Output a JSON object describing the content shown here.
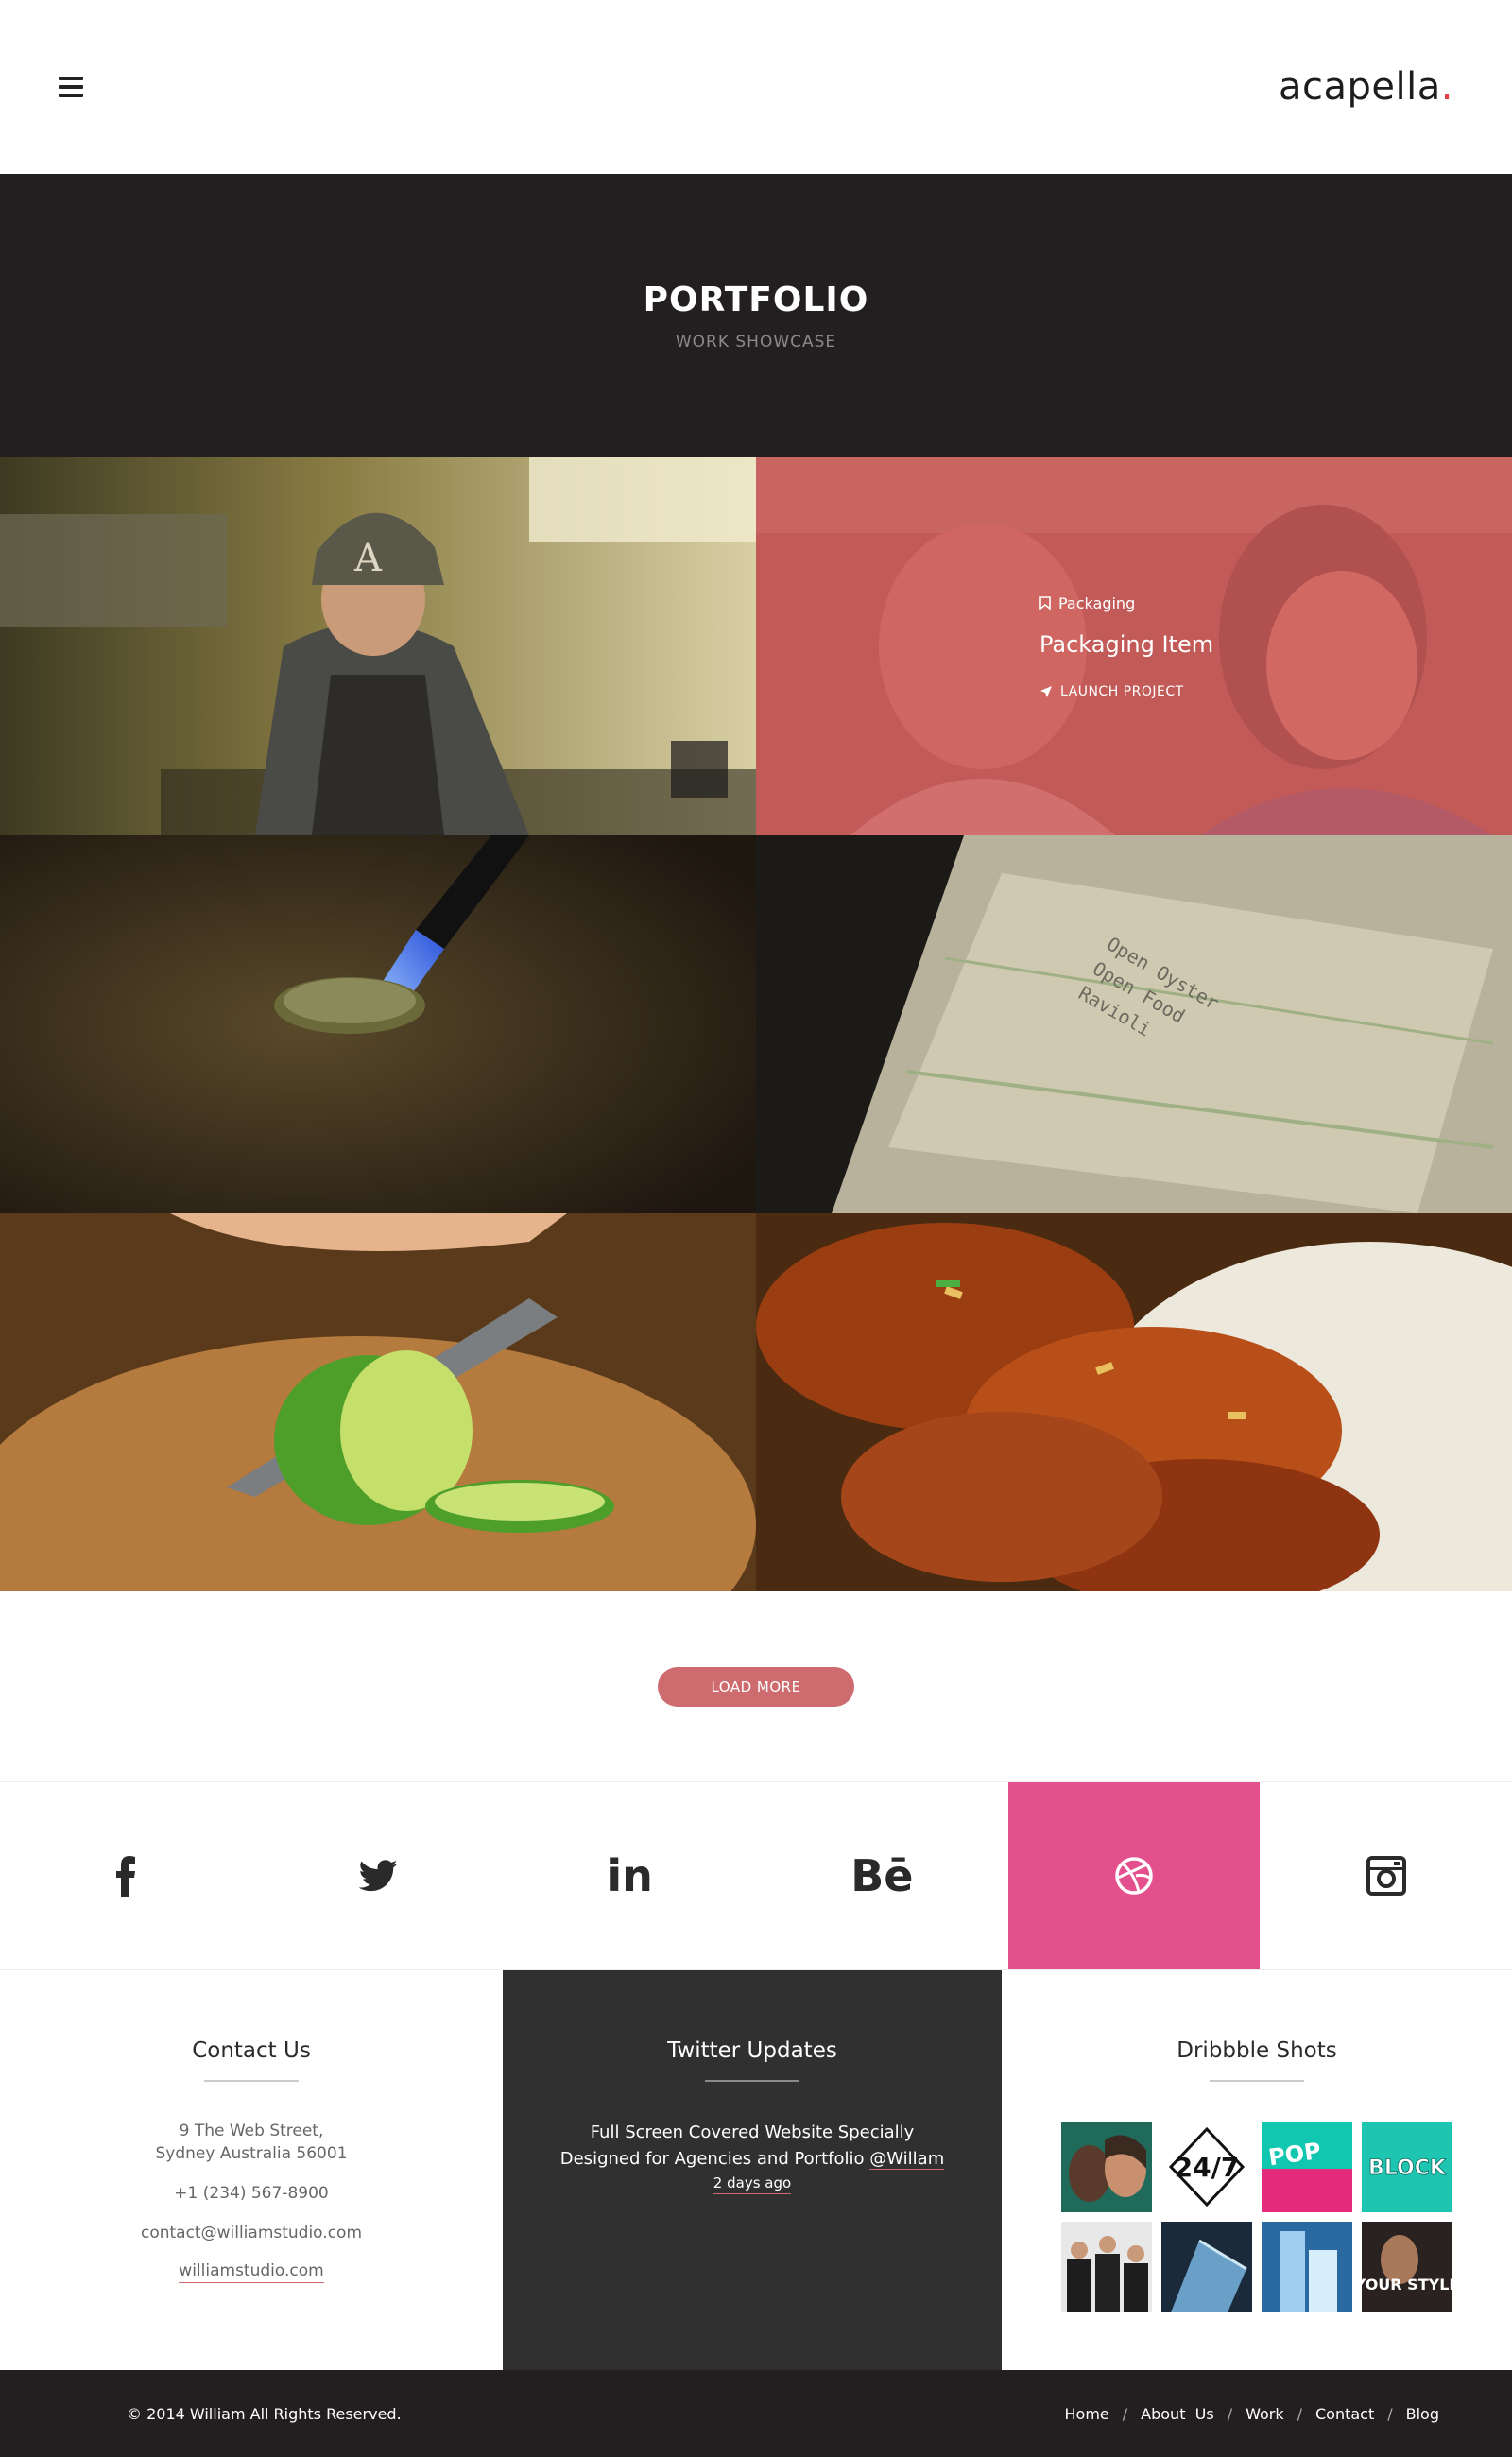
{
  "header": {
    "logo_text": "acapella",
    "logo_dot": ".",
    "menu_icon": "hamburger-icon"
  },
  "hero": {
    "title": "PORTFOLIO",
    "subtitle": "WORK SHOWCASE"
  },
  "portfolio": {
    "hover_item": {
      "category": "Packaging",
      "title": "Packaging Item",
      "link": "LAUNCH PROJECT"
    },
    "load_more": "LOAD MORE"
  },
  "social": [
    "facebook-icon",
    "twitter-icon",
    "linkedin-icon",
    "behance-icon",
    "dribbble-icon",
    "instagram-icon"
  ],
  "social_labels": {
    "linkedin": "in",
    "behance": "Bē"
  },
  "colors": {
    "accent": "#cd6b6f",
    "dribbble_active": "#e4508e",
    "dark": "#231f20",
    "overlay": "#d65f5f"
  },
  "contact": {
    "title": "Contact Us",
    "address_line1": "9 The Web Street,",
    "address_line2": "Sydney Australia 56001",
    "phone": "+1 (234) 567-8900",
    "email": "contact@williamstudio.com",
    "website": "williamstudio.com"
  },
  "twitter": {
    "title": "Twitter Updates",
    "line1": "Full Screen Covered Website Specially",
    "line2": "Designed for Agencies and Portfolio",
    "handle": "@Willam",
    "time": "2 days ago"
  },
  "dribbble": {
    "title": "Dribbble Shots",
    "shot_247": "24/7",
    "shot_pop": "POP",
    "shot_block": "BLOCK",
    "shot_style": "YOUR STYLE"
  },
  "footer": {
    "copyright": "© 2014 William All Rights Reserved.",
    "nav": [
      "Home",
      "About  Us",
      "Work",
      "Contact",
      "Blog"
    ],
    "separator": "/"
  }
}
